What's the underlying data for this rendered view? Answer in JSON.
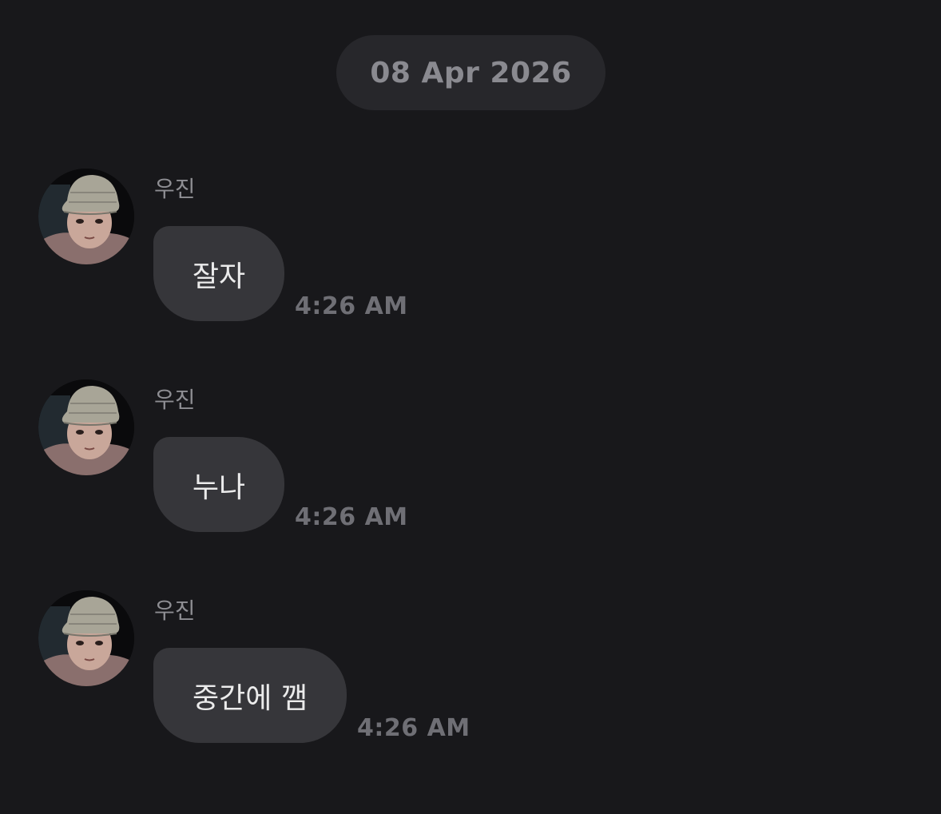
{
  "date_separator": {
    "label": "08 Apr 2026"
  },
  "messages": [
    {
      "sender": "우진",
      "text": "잘자",
      "time": "4:26 AM"
    },
    {
      "sender": "우진",
      "text": "누나",
      "time": "4:26 AM"
    },
    {
      "sender": "우진",
      "text": "중간에 깸",
      "time": "4:26 AM"
    }
  ],
  "colors": {
    "background": "#18181b",
    "bubble": "#36363a",
    "date_pill": "#27272b",
    "sender_name": "#8e8e93",
    "timestamp": "#6f6f75"
  }
}
